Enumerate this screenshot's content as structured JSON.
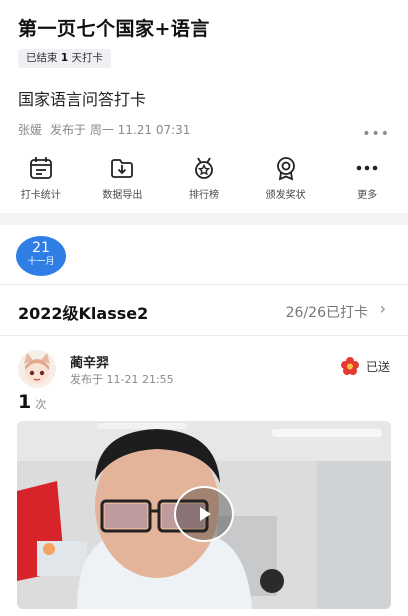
{
  "header": {
    "title": "第一页七个国家+语言",
    "badge_prefix": "已结束",
    "badge_count": "1",
    "badge_suffix": "天打卡",
    "subtitle": "国家语言问答打卡",
    "author": "张媛",
    "published": "发布于 周一 11.21 07:31"
  },
  "toolbar": {
    "items": [
      {
        "label": "打卡统计",
        "icon": "calendar-stats-icon"
      },
      {
        "label": "数据导出",
        "icon": "folder-download-icon"
      },
      {
        "label": "排行榜",
        "icon": "star-medal-icon"
      },
      {
        "label": "颁发奖状",
        "icon": "award-ribbon-icon"
      },
      {
        "label": "更多",
        "icon": "more-dots-icon"
      }
    ]
  },
  "date": {
    "day": "21",
    "month": "十一月"
  },
  "class_row": {
    "name": "2022级Klasse2",
    "count": "26/26已打卡"
  },
  "post": {
    "user": "蔺辛羿",
    "time": "发布于 11-21 21:55",
    "status": "已送",
    "times_value": "1",
    "times_unit": "次"
  },
  "colors": {
    "accent": "#2f7ee5",
    "flower": "#e53935"
  }
}
